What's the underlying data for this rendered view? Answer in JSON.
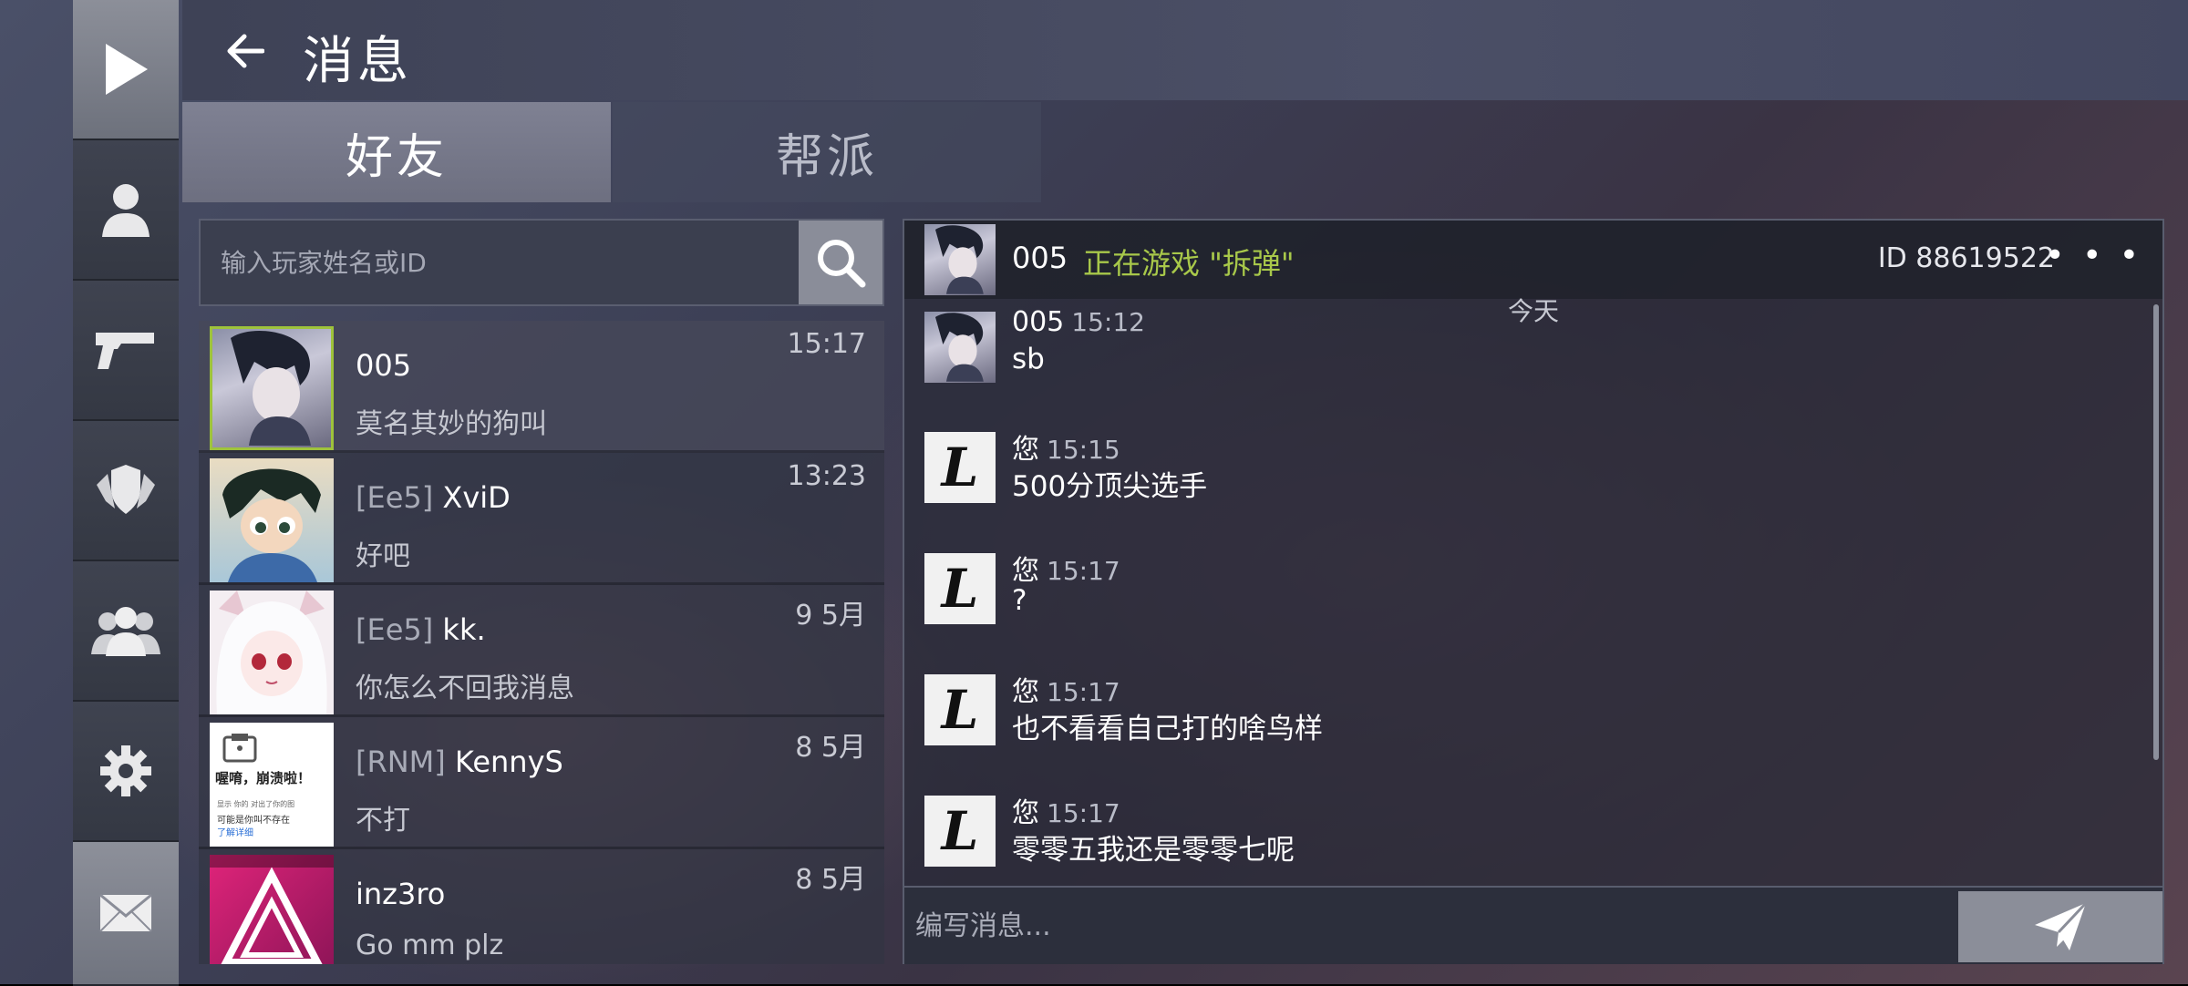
{
  "colors": {
    "status_green": "#a8c84a",
    "selected_border": "#9ec33b"
  },
  "sidebar": {
    "items": [
      {
        "icon": "play-icon"
      },
      {
        "icon": "person-icon"
      },
      {
        "icon": "pistol-icon"
      },
      {
        "icon": "shield-wings-icon"
      },
      {
        "icon": "group-icon"
      },
      {
        "icon": "gear-icon"
      },
      {
        "icon": "mail-icon"
      }
    ]
  },
  "header": {
    "title": "消息"
  },
  "tabs": [
    {
      "label": "好友"
    },
    {
      "label": "帮派"
    }
  ],
  "search": {
    "placeholder": "输入玩家姓名或ID"
  },
  "friends": [
    {
      "tag": "",
      "name": "005",
      "last_message": "莫名其妙的狗叫",
      "time": "15:17"
    },
    {
      "tag": "[Ee5]",
      "name": "XviD",
      "last_message": "好吧",
      "time": "13:23"
    },
    {
      "tag": "[Ee5]",
      "name": "kk.",
      "last_message": "你怎么不回我消息",
      "time": "9 5月"
    },
    {
      "tag": "[RNM]",
      "name": "KennyS",
      "last_message": "不打",
      "time": "8 5月"
    },
    {
      "tag": "",
      "name": "inz3ro",
      "last_message": "Go mm plz",
      "time": "8 5月"
    }
  ],
  "avatar_text": {
    "kennys_title": "喔唷，崩溃啦！",
    "kennys_line1": "显示 你的 对出了你的图",
    "kennys_line2": "可能是你叫不存在",
    "kennys_link": "了解详细"
  },
  "chat": {
    "contact_name": "005",
    "status": "正在游戏 \"拆弹\"",
    "id_label": "ID 88619522",
    "more": "• • •",
    "day_separator": "今天",
    "messages": [
      {
        "sender": "005",
        "time": "15:12",
        "text": "sb"
      },
      {
        "sender": "您",
        "time": "15:15",
        "text": "500分顶尖选手"
      },
      {
        "sender": "您",
        "time": "15:17",
        "text": "?"
      },
      {
        "sender": "您",
        "time": "15:17",
        "text": "也不看看自己打的啥鸟样"
      },
      {
        "sender": "您",
        "time": "15:17",
        "text": "零零五我还是零零七呢"
      }
    ],
    "my_avatar_letter": "L",
    "composer_placeholder": "编写消息..."
  }
}
